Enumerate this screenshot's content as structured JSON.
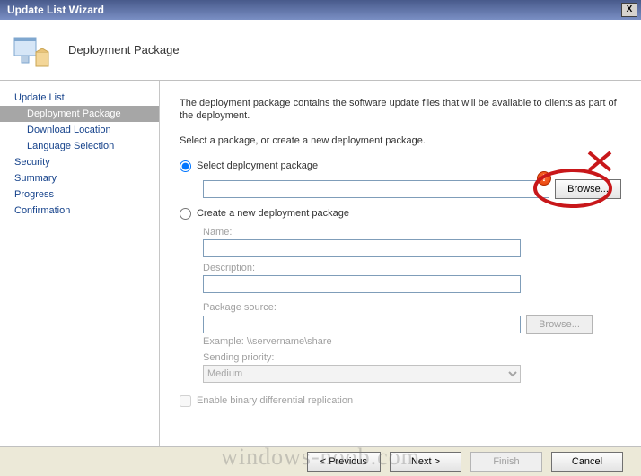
{
  "titlebar": {
    "title": "Update List Wizard",
    "close_label": "X"
  },
  "header": {
    "title": "Deployment Package"
  },
  "sidebar": {
    "items": [
      {
        "label": "Update List",
        "type": "parent"
      },
      {
        "label": "Deployment Package",
        "type": "sub",
        "active": true
      },
      {
        "label": "Download Location",
        "type": "sub"
      },
      {
        "label": "Language Selection",
        "type": "sub"
      },
      {
        "label": "Security",
        "type": "parent"
      },
      {
        "label": "Summary",
        "type": "parent"
      },
      {
        "label": "Progress",
        "type": "parent"
      },
      {
        "label": "Confirmation",
        "type": "parent"
      }
    ]
  },
  "main": {
    "description1": "The deployment package contains the software update files that will be available to clients as part of the deployment.",
    "description2": "Select a package, or create a new deployment package.",
    "radio_select_label": "Select deployment package",
    "radio_create_label": "Create a new deployment package",
    "browse_label": "Browse...",
    "name_label": "Name:",
    "desc_label": "Description:",
    "pkg_source_label": "Package source:",
    "example_label": "Example: \\\\servername\\share",
    "sending_label": "Sending priority:",
    "sending_value": "Medium",
    "checkbox_label": "Enable binary differential replication",
    "select_value": "",
    "name_value": "",
    "desc_value": "",
    "pkg_source_value": ""
  },
  "buttons": {
    "previous": "< Previous",
    "next": "Next >",
    "finish": "Finish",
    "cancel": "Cancel"
  },
  "watermark": "windows-noob.com"
}
